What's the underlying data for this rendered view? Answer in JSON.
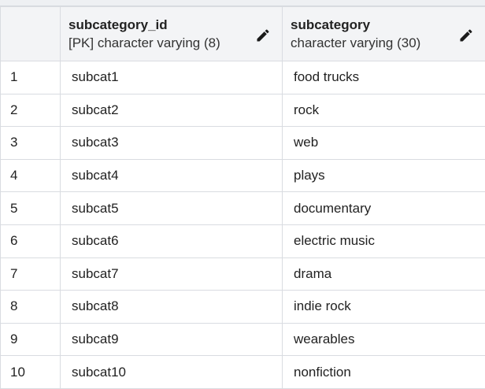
{
  "table": {
    "columns": [
      {
        "name": "subcategory_id",
        "type": "[PK] character varying (8)"
      },
      {
        "name": "subcategory",
        "type": "character varying (30)"
      }
    ],
    "rows": [
      {
        "num": "1",
        "subcategory_id": "subcat1",
        "subcategory": "food trucks"
      },
      {
        "num": "2",
        "subcategory_id": "subcat2",
        "subcategory": "rock"
      },
      {
        "num": "3",
        "subcategory_id": "subcat3",
        "subcategory": "web"
      },
      {
        "num": "4",
        "subcategory_id": "subcat4",
        "subcategory": "plays"
      },
      {
        "num": "5",
        "subcategory_id": "subcat5",
        "subcategory": "documentary"
      },
      {
        "num": "6",
        "subcategory_id": "subcat6",
        "subcategory": "electric music"
      },
      {
        "num": "7",
        "subcategory_id": "subcat7",
        "subcategory": "drama"
      },
      {
        "num": "8",
        "subcategory_id": "subcat8",
        "subcategory": "indie rock"
      },
      {
        "num": "9",
        "subcategory_id": "subcat9",
        "subcategory": "wearables"
      },
      {
        "num": "10",
        "subcategory_id": "subcat10",
        "subcategory": "nonfiction"
      }
    ]
  },
  "icons": {
    "edit": "pencil-icon"
  }
}
